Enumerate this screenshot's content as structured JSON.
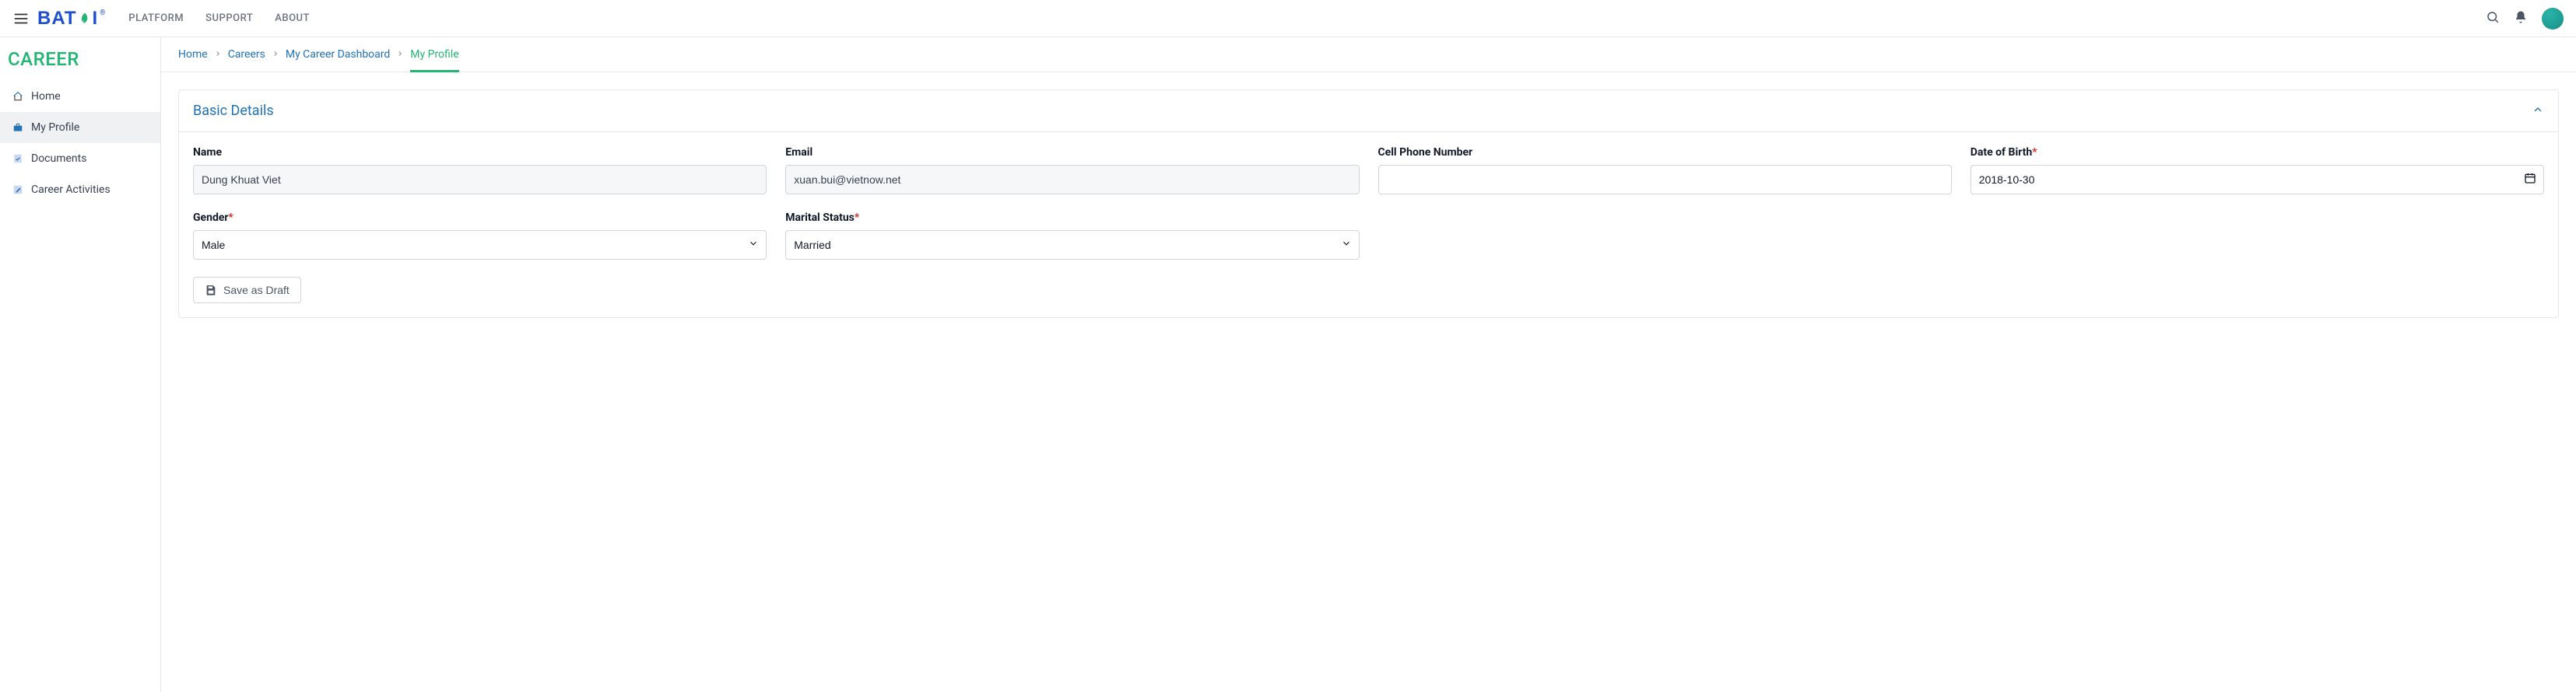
{
  "topnav": {
    "platform": "PLATFORM",
    "support": "SUPPORT",
    "about": "ABOUT"
  },
  "sidebar": {
    "title": "CAREER",
    "items": [
      {
        "label": "Home"
      },
      {
        "label": "My Profile"
      },
      {
        "label": "Documents"
      },
      {
        "label": "Career Activities"
      }
    ]
  },
  "breadcrumb": {
    "home": "Home",
    "careers": "Careers",
    "dashboard": "My Career Dashboard",
    "current": "My Profile"
  },
  "card": {
    "title": "Basic Details"
  },
  "form": {
    "name": {
      "label": "Name",
      "value": "Dung Khuat Viet"
    },
    "email": {
      "label": "Email",
      "value": "xuan.bui@vietnow.net"
    },
    "phone": {
      "label": "Cell Phone Number",
      "value": ""
    },
    "dob": {
      "label": "Date of Birth",
      "value": "2018-10-30"
    },
    "gender": {
      "label": "Gender",
      "value": "Male"
    },
    "marital": {
      "label": "Marital Status",
      "value": "Married"
    }
  },
  "actions": {
    "save_draft": "Save as Draft"
  }
}
